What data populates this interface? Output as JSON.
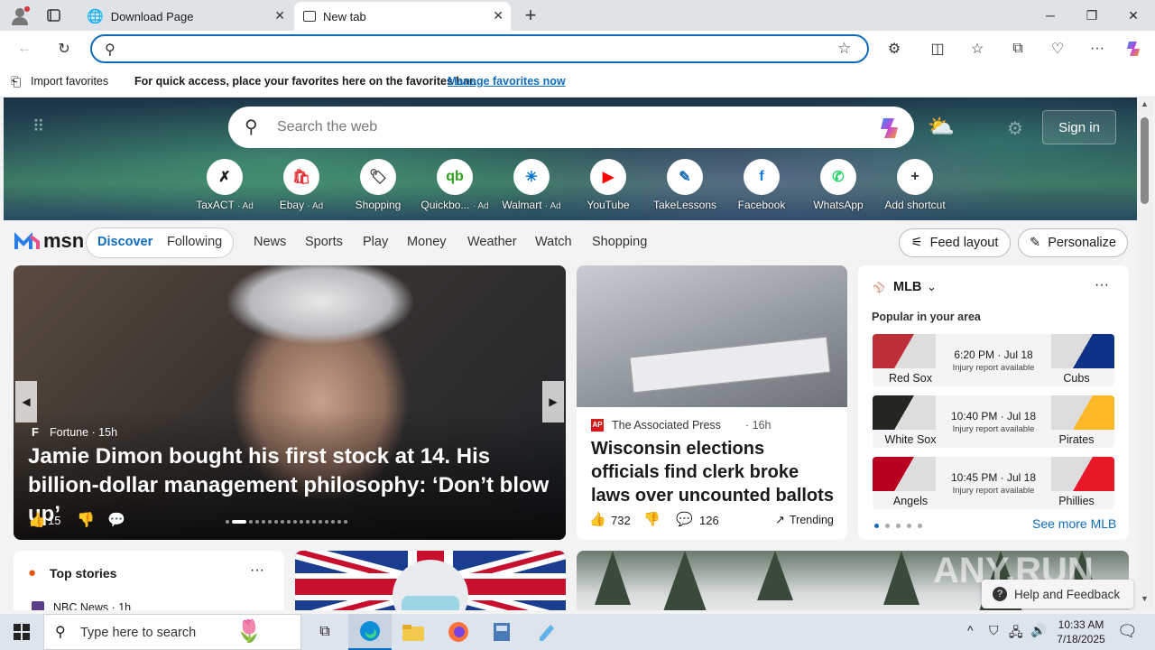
{
  "titlebar": {
    "tabs": [
      {
        "title": "Download Page",
        "active": false
      },
      {
        "title": "New tab",
        "active": true
      }
    ],
    "new_tab": "+",
    "window_controls": [
      "minimize",
      "restore",
      "close"
    ]
  },
  "toolbar": {
    "address_value": "",
    "icons": [
      "back-icon",
      "refresh-icon",
      "extensions-icon",
      "split-screen-icon",
      "favorites-icon",
      "collections-icon",
      "browser-essentials-icon",
      "more-icon",
      "copilot-icon"
    ]
  },
  "favbar": {
    "import_label": "Import favorites",
    "message": "For quick access, place your favorites here on the favorites bar.",
    "manage_link": "Manage favorites now"
  },
  "hero": {
    "search_placeholder": "Search the web",
    "sign_in": "Sign in",
    "shortcuts": [
      {
        "label": "TaxACT",
        "ad": "· Ad",
        "glyph": "✗",
        "color": "#1a1a1a"
      },
      {
        "label": "Ebay",
        "ad": "· Ad",
        "glyph": "🛍",
        "color": "#e53238"
      },
      {
        "label": "Shopping",
        "ad": "",
        "glyph": "🏷",
        "color": "#444"
      },
      {
        "label": "Quickbo...",
        "ad": "· Ad",
        "glyph": "qb",
        "color": "#2ca01c"
      },
      {
        "label": "Walmart",
        "ad": "· Ad",
        "glyph": "✳",
        "color": "#0071ce"
      },
      {
        "label": "YouTube",
        "ad": "",
        "glyph": "▶",
        "color": "#ff0000"
      },
      {
        "label": "TakeLessons",
        "ad": "",
        "glyph": "✎",
        "color": "#1e6fb8"
      },
      {
        "label": "Facebook",
        "ad": "",
        "glyph": "f",
        "color": "#1877f2"
      },
      {
        "label": "WhatsApp",
        "ad": "",
        "glyph": "✆",
        "color": "#25d366"
      },
      {
        "label": "Add shortcut",
        "ad": "",
        "glyph": "+",
        "color": "#333"
      }
    ]
  },
  "msn": {
    "logo": "msn",
    "tabs": [
      "Discover",
      "Following"
    ],
    "nav": [
      "News",
      "Sports",
      "Play",
      "Money",
      "Weather",
      "Watch",
      "Shopping"
    ],
    "feed_layout": "Feed layout",
    "personalize": "Personalize"
  },
  "main_story": {
    "source": "Fortune · 15h",
    "headline": "Jamie Dimon bought his first stock at 14. His billion-dollar management philosophy: ‘Don’t blow up’",
    "likes": "15"
  },
  "second_story": {
    "source": "The Associated Press",
    "age": "· 16h",
    "headline": "Wisconsin elections officials find clerk broke laws over uncounted ballots",
    "likes": "732",
    "comments": "126",
    "trending": "Trending"
  },
  "mlb": {
    "title": "MLB",
    "subtitle": "Popular in your area",
    "games": [
      {
        "home": "Red Sox",
        "away": "Cubs",
        "time": "6:20 PM · Jul 18",
        "note": "Injury report available",
        "home_color": "#bd3039",
        "away_color": "#0e3386"
      },
      {
        "home": "White Sox",
        "away": "Pirates",
        "time": "10:40 PM · Jul 18",
        "note": "Injury report available",
        "home_color": "#27251f",
        "away_color": "#fdb827"
      },
      {
        "home": "Angels",
        "away": "Phillies",
        "time": "10:45 PM · Jul 18",
        "note": "Injury report available",
        "home_color": "#ba0021",
        "away_color": "#e81828"
      }
    ],
    "see_more": "See more MLB"
  },
  "top_stories": {
    "title": "Top stories",
    "source": "NBC News · 1h"
  },
  "feedback": "Help and Feedback",
  "taskbar": {
    "search_placeholder": "Type here to search",
    "time": "10:33 AM",
    "date": "7/18/2025"
  },
  "colors": {
    "accent": "#0f6cbd",
    "link": "#0f6cbd"
  }
}
